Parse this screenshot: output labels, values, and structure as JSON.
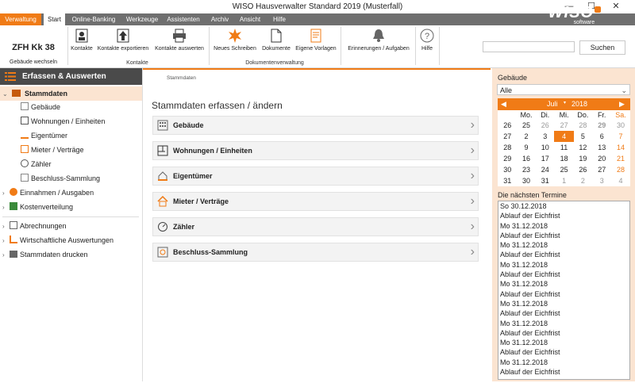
{
  "window": {
    "title": "WISO Hausverwalter Standard 2019 (Musterfall)",
    "controls": [
      "—",
      "☐",
      "✕"
    ]
  },
  "tabs": [
    "Verwaltung",
    "Start",
    "Online-Banking",
    "Werkzeuge",
    "Assistenten",
    "Archiv",
    "Ansicht",
    "Hilfe"
  ],
  "brand": {
    "name": "WISO",
    "sub": "software",
    "accent": "#f07b16"
  },
  "ribbon": {
    "building": {
      "title": "ZFH Kk 38",
      "sub": "Gebäude wechseln"
    },
    "kontakte": {
      "buttons": [
        "Kontakte",
        "Kontakte exportieren",
        "Kontakte auswerten"
      ],
      "group": "Kontakte"
    },
    "dokumente": {
      "buttons": [
        "Neues Schreiben",
        "Dokumente",
        "Eigene Vorlagen"
      ],
      "group": "Dokumentenverwaltung"
    },
    "erinnerungen": "Erinnerungen / Aufgaben",
    "hilfe": "Hilfe",
    "search": {
      "value": "",
      "button": "Suchen"
    }
  },
  "sidebar": {
    "header": "Erfassen & Auswerten",
    "stammdaten": "Stammdaten",
    "sub_items": [
      "Gebäude",
      "Wohnungen / Einheiten",
      "Eigentümer",
      "Mieter / Verträge",
      "Zähler",
      "Beschluss-Sammlung"
    ],
    "items_group1": [
      "Einnahmen / Ausgaben",
      "Kostenverteilung"
    ],
    "items_group2": [
      "Abrechnungen",
      "Wirtschaftliche Auswertungen",
      "Stammdaten drucken"
    ]
  },
  "main": {
    "breadcrumb": "Stammdaten",
    "title": "Stammdaten erfassen / ändern",
    "rows": [
      "Gebäude",
      "Wohnungen / Einheiten",
      "Eigentümer",
      "Mieter / Verträge",
      "Zähler",
      "Beschluss-Sammlung"
    ]
  },
  "rpanel": {
    "gebaeude_label": "Gebäude",
    "gebaeude_value": "Alle",
    "calendar": {
      "month": "Juli",
      "year": "2018",
      "weekdays": [
        "Mo.",
        "Di.",
        "Mi.",
        "Do.",
        "Fr.",
        "Sa."
      ],
      "weeks": [
        [
          "26",
          "25",
          "26",
          "27",
          "28",
          "29",
          "30"
        ],
        [
          "27",
          "2",
          "3",
          "4",
          "5",
          "6",
          "7"
        ],
        [
          "28",
          "9",
          "10",
          "11",
          "12",
          "13",
          "14"
        ],
        [
          "29",
          "16",
          "17",
          "18",
          "19",
          "20",
          "21"
        ],
        [
          "30",
          "23",
          "24",
          "25",
          "26",
          "27",
          "28"
        ],
        [
          "31",
          "30",
          "31",
          "1",
          "2",
          "3",
          "4"
        ]
      ],
      "selected_day": "4"
    },
    "termine_label": "Die nächsten Termine",
    "termine": [
      "So 30.12.2018",
      "Ablauf der Eichfrist",
      "Mo 31.12.2018",
      "Ablauf der Eichfrist",
      "Mo 31.12.2018",
      "Ablauf der Eichfrist",
      "Mo 31.12.2018",
      "Ablauf der Eichfrist",
      "Mo 31.12.2018",
      "Ablauf der Eichfrist",
      "Mo 31.12.2018",
      "Ablauf der Eichfrist",
      "Mo 31.12.2018",
      "Ablauf der Eichfrist",
      "Mo 31.12.2018",
      "Ablauf der Eichfrist",
      "Mo 31.12.2018",
      "Ablauf der Eichfrist"
    ]
  }
}
